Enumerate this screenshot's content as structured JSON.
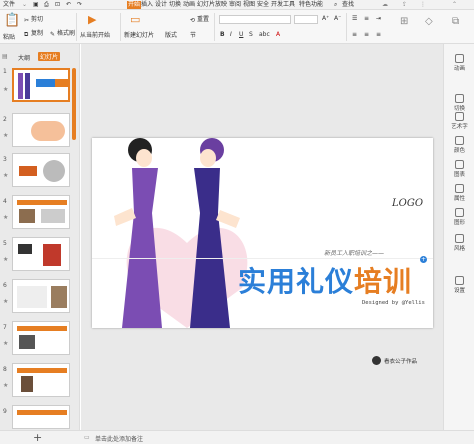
{
  "menubar": {
    "file": "文件",
    "items": [
      "开始",
      "插入",
      "设计",
      "切换",
      "动画",
      "幻灯片放映",
      "审阅",
      "视图",
      "安全",
      "开发工具",
      "特色功能"
    ],
    "search": "查找"
  },
  "ribbon": {
    "paste": "粘贴",
    "cut": "剪切",
    "copy": "复制",
    "format_painter": "格式刷",
    "from_current": "从当前开始",
    "new_slide": "新建幻灯片",
    "layout": "版式",
    "section": "节",
    "reset": "重置"
  },
  "left": {
    "tabs": [
      "大纲",
      "幻灯片"
    ]
  },
  "thumbs": [
    "1",
    "2",
    "3",
    "4",
    "5",
    "6",
    "7",
    "8",
    "9"
  ],
  "slide": {
    "logo": "LOGO",
    "subtitle": "新员工入职培训之——",
    "title_part1": "实用礼仪",
    "title_part2": "培训",
    "designer": "Designed by @Yellis",
    "author": "看衣公子作品"
  },
  "rightbar": [
    "动画",
    "切换",
    "艺术字",
    "颜色",
    "图表",
    "属性",
    "图形",
    "风格",
    "设置"
  ],
  "status": {
    "notes": "单击此处添加备注"
  },
  "colors": {
    "accent": "#e67e22",
    "title_blue": "#2b7fd8",
    "title_orange": "#e67e22"
  }
}
